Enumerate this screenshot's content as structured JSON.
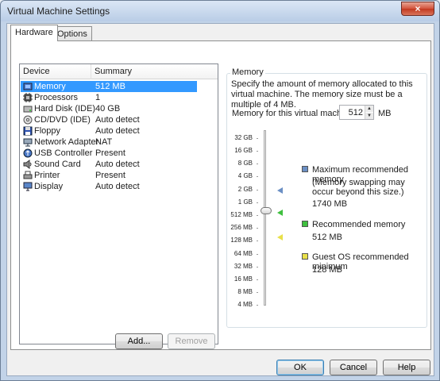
{
  "window": {
    "title": "Virtual Machine Settings",
    "close_glyph": "×"
  },
  "tabs": [
    {
      "label": "Hardware"
    },
    {
      "label": "Options"
    }
  ],
  "device_list": {
    "headers": {
      "device": "Device",
      "summary": "Summary"
    },
    "rows": [
      {
        "device": "Memory",
        "summary": "512 MB",
        "icon": "memory-icon",
        "selected": true
      },
      {
        "device": "Processors",
        "summary": "1",
        "icon": "processor-icon"
      },
      {
        "device": "Hard Disk (IDE)",
        "summary": "40 GB",
        "icon": "hard-disk-icon"
      },
      {
        "device": "CD/DVD (IDE)",
        "summary": "Auto detect",
        "icon": "cd-dvd-icon"
      },
      {
        "device": "Floppy",
        "summary": "Auto detect",
        "icon": "floppy-icon"
      },
      {
        "device": "Network Adapter",
        "summary": "NAT",
        "icon": "network-adapter-icon"
      },
      {
        "device": "USB Controller",
        "summary": "Present",
        "icon": "usb-icon"
      },
      {
        "device": "Sound Card",
        "summary": "Auto detect",
        "icon": "sound-card-icon"
      },
      {
        "device": "Printer",
        "summary": "Present",
        "icon": "printer-icon"
      },
      {
        "device": "Display",
        "summary": "Auto detect",
        "icon": "display-icon"
      }
    ]
  },
  "buttons": {
    "add": "Add...",
    "remove": "Remove",
    "ok": "OK",
    "cancel": "Cancel",
    "help": "Help"
  },
  "memory": {
    "group_title": "Memory",
    "description": "Specify the amount of memory allocated to this virtual machine. The memory size must be a multiple of 4 MB.",
    "field_label": "Memory for this virtual machine:",
    "value": "512",
    "unit": "MB",
    "scale": [
      "32 GB",
      "16 GB",
      "8 GB",
      "4 GB",
      "2 GB",
      "1 GB",
      "512 MB",
      "256 MB",
      "128 MB",
      "64 MB",
      "32 MB",
      "16 MB",
      "8 MB",
      "4 MB"
    ],
    "slider_value": "512 MB",
    "legend": {
      "max_title": "Maximum recommended memory",
      "max_note": "(Memory swapping may occur beyond this size.)",
      "max_value": "1740 MB",
      "rec_title": "Recommended memory",
      "rec_value": "512 MB",
      "guest_title": "Guest OS recommended minimum",
      "guest_value": "128 MB"
    },
    "colors": {
      "max": "#6b8fc4",
      "recommended": "#3fbf3f",
      "guest_min": "#e8e04a"
    }
  }
}
